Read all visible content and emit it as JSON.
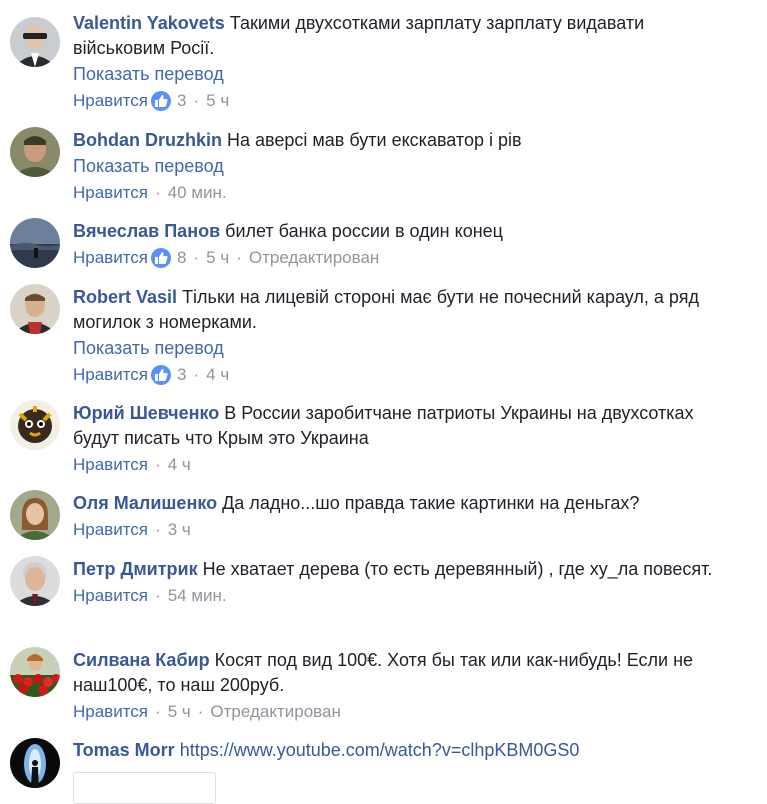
{
  "comments": [
    {
      "author": "Valentin Yakovets",
      "text": "Такими двухсотками зарплату зарплату видавати військовим Росії.",
      "translate": "Показать перевод",
      "like": "Нравится",
      "likes": "3",
      "time": "5 ч"
    },
    {
      "author": "Bohdan Druzhkin",
      "text": "На аверсі мав бути екскаватор і рів",
      "translate": "Показать перевод",
      "like": "Нравится",
      "time": "40 мин."
    },
    {
      "author": "Вячеслав Панов",
      "text": "билет банка россии в один конец",
      "like": "Нравится",
      "likes": "8",
      "time": "5 ч",
      "edited": "Отредактирован"
    },
    {
      "author": "Robert Vasil",
      "text": "Тільки на лицевій стороні має бути не почесний караул, а ряд могилок з номерками.",
      "translate": "Показать перевод",
      "like": "Нравится",
      "likes": "3",
      "time": "4 ч"
    },
    {
      "author": "Юрий Шевченко",
      "text": "В России заробитчане патриоты Украины на двухсотках будут писать что Крым это Украина",
      "like": "Нравится",
      "time": "4 ч"
    },
    {
      "author": "Оля Малишенко",
      "text": "Да ладно...шо правда такие картинки на деньгах?",
      "like": "Нравится",
      "time": "3 ч"
    },
    {
      "author": "Петр Дмитрик",
      "text": "Не хватает дерева (то есть деревянный) , где ху_ла повесят.",
      "like": "Нравится",
      "time": "54 мин."
    },
    {
      "author": "Силвана Кабир",
      "text": "Косят под вид 100€. Хотя бы так или как-нибудь! Если не наш100€, то наш 200руб.",
      "like": "Нравится",
      "time": "5 ч",
      "edited": "Отредактирован"
    },
    {
      "author": "Tomas Morr",
      "link": "https://www.youtube.com/watch?v=clhpKBM0GS0"
    }
  ],
  "separator": "·",
  "colors": {
    "author": "#385898",
    "link": "#4267b2",
    "meta": "#90949c",
    "like_badge": "#5890ff",
    "text": "#1d2129"
  },
  "icons": {
    "like_badge": "thumbs-up-icon"
  }
}
